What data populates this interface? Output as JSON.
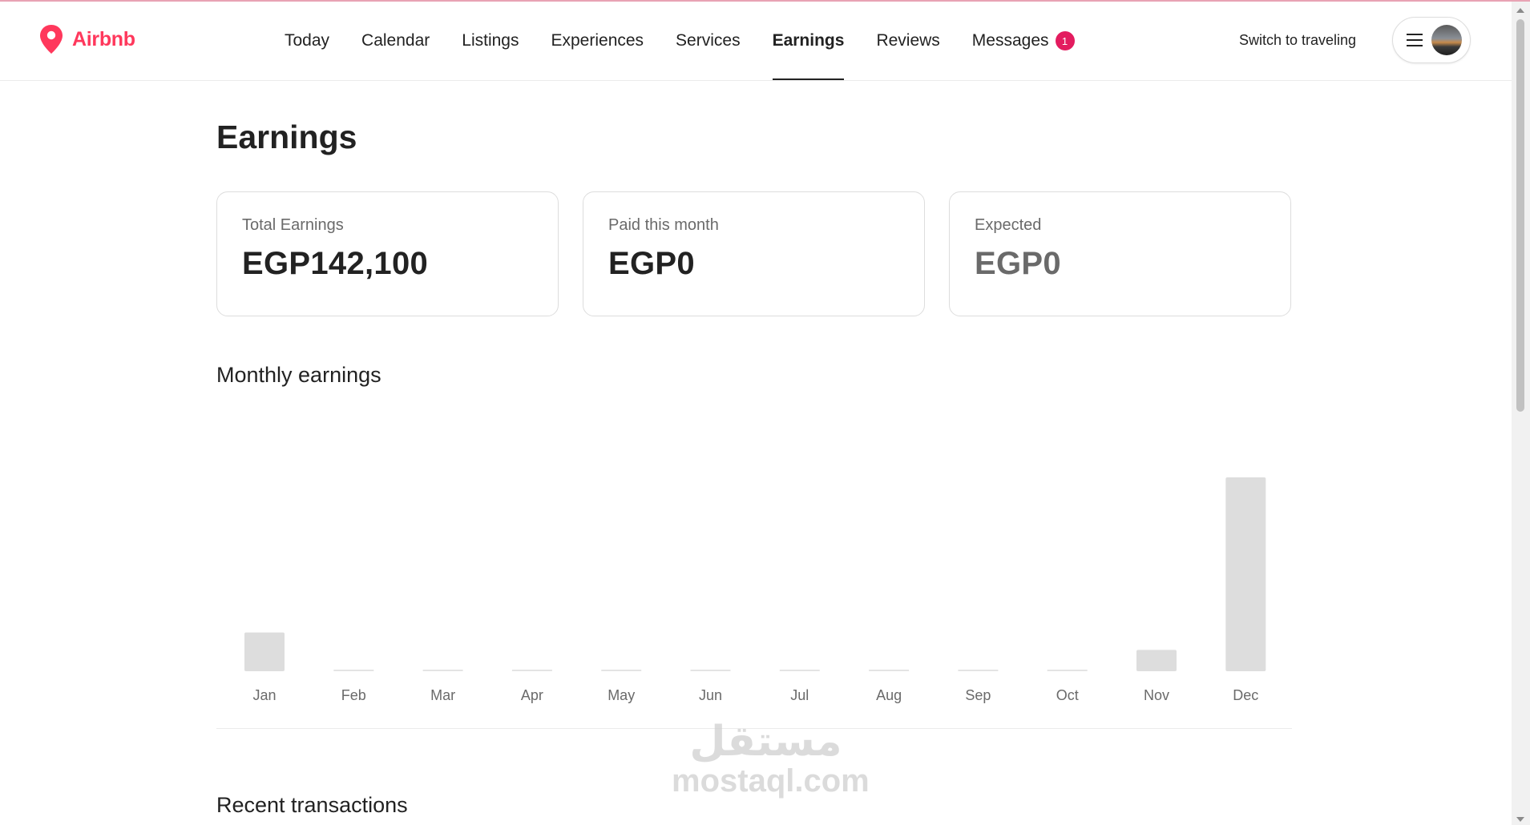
{
  "brand": {
    "name": "Airbnb",
    "color": "#ff385c",
    "icon": "airbnb-pin-icon"
  },
  "nav": {
    "items": [
      {
        "label": "Today"
      },
      {
        "label": "Calendar"
      },
      {
        "label": "Listings"
      },
      {
        "label": "Experiences"
      },
      {
        "label": "Services"
      },
      {
        "label": "Earnings",
        "active": true
      },
      {
        "label": "Reviews"
      },
      {
        "label": "Messages",
        "badge": "1"
      }
    ],
    "switch_label": "Switch to traveling",
    "menu_icon": "hamburger-menu-icon",
    "badge_color": "#e31c5f"
  },
  "page": {
    "title": "Earnings"
  },
  "summary": {
    "total": {
      "label": "Total Earnings",
      "value": "EGP142,100"
    },
    "paid": {
      "label": "Paid this month",
      "value": "EGP0"
    },
    "expected": {
      "label": "Expected",
      "value": "EGP0"
    }
  },
  "monthly": {
    "title": "Monthly earnings"
  },
  "chart_data": {
    "type": "bar",
    "title": "Monthly earnings",
    "categories": [
      "Jan",
      "Feb",
      "Mar",
      "Apr",
      "May",
      "Jun",
      "Jul",
      "Aug",
      "Sep",
      "Oct",
      "Nov",
      "Dec"
    ],
    "values": [
      20,
      0,
      0,
      0,
      0,
      0,
      0,
      0,
      0,
      0,
      11,
      100
    ],
    "value_scale": "relative height (0-100), no y-axis printed",
    "grid": false,
    "bar_color": "#dddddd"
  },
  "transactions": {
    "title": "Recent transactions"
  },
  "watermark": {
    "arabic": "مستقل",
    "latin": "mostaql.com"
  }
}
